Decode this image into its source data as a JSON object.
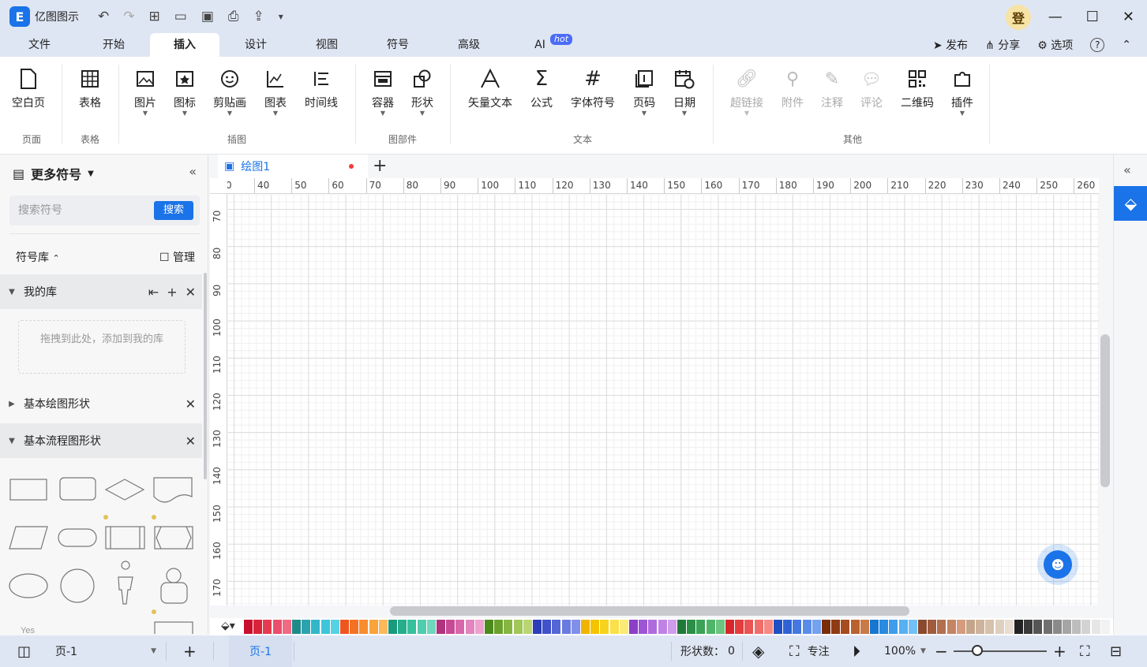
{
  "app": {
    "name": "亿图图示",
    "logo": "E",
    "login_label": "登"
  },
  "menu": {
    "tabs": [
      "文件",
      "开始",
      "插入",
      "设计",
      "视图",
      "符号",
      "高级",
      "AI"
    ],
    "active": "插入",
    "hot_badge": "hot",
    "right": {
      "publish": "发布",
      "share": "分享",
      "options": "选项",
      "help": "?"
    }
  },
  "ribbon": {
    "buttons": [
      "空白页",
      "表格",
      "图片",
      "图标",
      "剪贴画",
      "图表",
      "时间线",
      "容器",
      "形状",
      "矢量文本",
      "公式",
      "字体符号",
      "页码",
      "日期",
      "超链接",
      "附件",
      "注释",
      "评论",
      "二维码",
      "插件"
    ],
    "groups": [
      "页面",
      "表格",
      "插图",
      "图部件",
      "文本",
      "其他"
    ]
  },
  "left_panel": {
    "title": "更多符号",
    "search_placeholder": "搜索符号",
    "search_button": "搜索",
    "library_label": "符号库",
    "manage_label": "管理",
    "libraries": [
      "我的库",
      "基本绘图形状",
      "基本流程图形状"
    ],
    "drop_hint": "拖拽到此处，添加到我的库",
    "shape_text": "Yes"
  },
  "document": {
    "tab_name": "绘图1",
    "unsaved_indicator": "●"
  },
  "rulers": {
    "top": [
      "0",
      "40",
      "50",
      "60",
      "70",
      "80",
      "90",
      "100",
      "110",
      "120",
      "130",
      "140",
      "150",
      "160",
      "170",
      "180",
      "190",
      "200",
      "210",
      "220",
      "230",
      "240",
      "250",
      "260"
    ],
    "left": [
      "70",
      "80",
      "90",
      "100",
      "110",
      "120",
      "130",
      "140",
      "150",
      "160",
      "170"
    ]
  },
  "status": {
    "page_select": "页-1",
    "page_tab": "页-1",
    "shape_count_label": "形状数：",
    "shape_count": "0",
    "focus_label": "专注",
    "zoom": "100%"
  },
  "palette_colors": [
    "#c8102e",
    "#d92338",
    "#e43b50",
    "#e94f6c",
    "#f06a82",
    "#1f8a8a",
    "#2ba3ae",
    "#32b6c9",
    "#3ec5d9",
    "#56d2e5",
    "#f0551e",
    "#f47124",
    "#f88c2e",
    "#f9a33b",
    "#fbb95b",
    "#1a9a7c",
    "#24ae8c",
    "#36c09d",
    "#4fcdae",
    "#6fd7be",
    "#b1337e",
    "#c74a94",
    "#d867aa",
    "#e385be",
    "#eda2cf",
    "#4d8a1e",
    "#6aa12d",
    "#86b541",
    "#a0c757",
    "#b9d673",
    "#2c3eb8",
    "#3f52c9",
    "#5466d6",
    "#6a7be0",
    "#8090e8",
    "#f0b400",
    "#f5c400",
    "#f8d31c",
    "#fae049",
    "#fcea77",
    "#8b3fc6",
    "#9d55d3",
    "#af6bdd",
    "#c083e5",
    "#cf9cec",
    "#1f7a3a",
    "#2c8f47",
    "#3aa356",
    "#4fb568",
    "#6bc47f",
    "#d8262c",
    "#e33d3e",
    "#ea5553",
    "#f06e6a",
    "#f58a84",
    "#1e4fc4",
    "#2f63d4",
    "#4478e0",
    "#5a8de8",
    "#74a2ef",
    "#7a2d0a",
    "#8f3a12",
    "#a64c1e",
    "#b9612f",
    "#c87a49",
    "#1677d2",
    "#2a8ae0",
    "#3f9deb",
    "#57b0f2",
    "#72c1f6",
    "#8a4a2e",
    "#a05c3d",
    "#b3704f",
    "#c48564",
    "#d49c7d",
    "#c5a58a",
    "#cdb39b",
    "#d6c1ac",
    "#dfcfbf",
    "#e8ddd1",
    "#222222",
    "#3a3a3a",
    "#555555",
    "#707070",
    "#8a8a8a",
    "#a5a5a5",
    "#bdbdbd",
    "#d3d3d3",
    "#e6e6e6",
    "#f2f2f2"
  ]
}
